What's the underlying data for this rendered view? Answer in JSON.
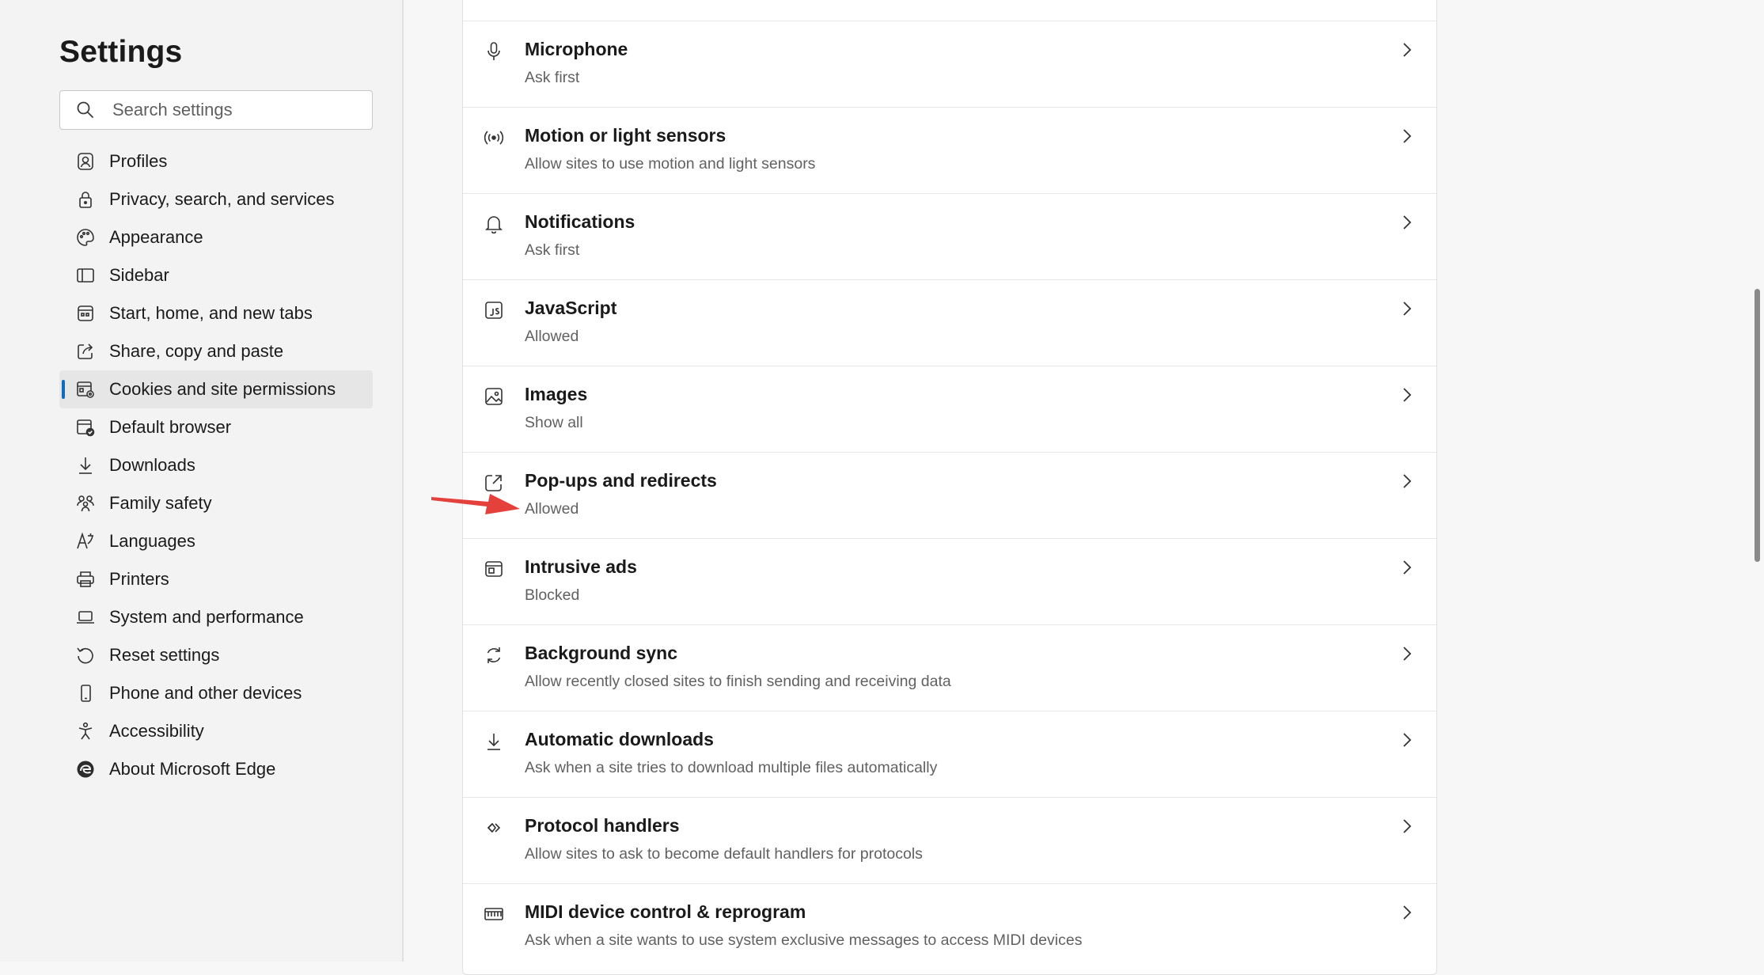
{
  "sidebar": {
    "title": "Settings",
    "search": {
      "placeholder": "Search settings",
      "value": ""
    },
    "items": [
      {
        "label": "Profiles",
        "icon": "profile-icon"
      },
      {
        "label": "Privacy, search, and services",
        "icon": "lock-icon"
      },
      {
        "label": "Appearance",
        "icon": "palette-icon"
      },
      {
        "label": "Sidebar",
        "icon": "sidebar-icon"
      },
      {
        "label": "Start, home, and new tabs",
        "icon": "start-home-icon"
      },
      {
        "label": "Share, copy and paste",
        "icon": "share-icon"
      },
      {
        "label": "Cookies and site permissions",
        "icon": "cookies-permissions-icon",
        "active": true
      },
      {
        "label": "Default browser",
        "icon": "default-browser-icon"
      },
      {
        "label": "Downloads",
        "icon": "download-icon"
      },
      {
        "label": "Family safety",
        "icon": "family-icon"
      },
      {
        "label": "Languages",
        "icon": "languages-icon"
      },
      {
        "label": "Printers",
        "icon": "printer-icon"
      },
      {
        "label": "System and performance",
        "icon": "laptop-icon"
      },
      {
        "label": "Reset settings",
        "icon": "reset-icon"
      },
      {
        "label": "Phone and other devices",
        "icon": "phone-icon"
      },
      {
        "label": "Accessibility",
        "icon": "accessibility-icon"
      },
      {
        "label": "About Microsoft Edge",
        "icon": "edge-logo-icon"
      }
    ]
  },
  "permissions": [
    {
      "title": "Microphone",
      "subtitle": "Ask first",
      "icon": "microphone-icon"
    },
    {
      "title": "Motion or light sensors",
      "subtitle": "Allow sites to use motion and light sensors",
      "icon": "sensors-icon"
    },
    {
      "title": "Notifications",
      "subtitle": "Ask first",
      "icon": "bell-icon"
    },
    {
      "title": "JavaScript",
      "subtitle": "Allowed",
      "icon": "javascript-icon"
    },
    {
      "title": "Images",
      "subtitle": "Show all",
      "icon": "image-icon"
    },
    {
      "title": "Pop-ups and redirects",
      "subtitle": "Allowed",
      "icon": "popup-icon"
    },
    {
      "title": "Intrusive ads",
      "subtitle": "Blocked",
      "icon": "ads-icon"
    },
    {
      "title": "Background sync",
      "subtitle": "Allow recently closed sites to finish sending and receiving data",
      "icon": "sync-icon"
    },
    {
      "title": "Automatic downloads",
      "subtitle": "Ask when a site tries to download multiple files automatically",
      "icon": "download-icon"
    },
    {
      "title": "Protocol handlers",
      "subtitle": "Allow sites to ask to become default handlers for protocols",
      "icon": "protocol-icon"
    },
    {
      "title": "MIDI device control & reprogram",
      "subtitle": "Ask when a site wants to use system exclusive messages to access MIDI devices",
      "icon": "midi-icon"
    }
  ],
  "colors": {
    "accent": "#0f6cbd",
    "annotation_arrow": "#e5413c",
    "active_item_bg": "#e6e6e6"
  }
}
